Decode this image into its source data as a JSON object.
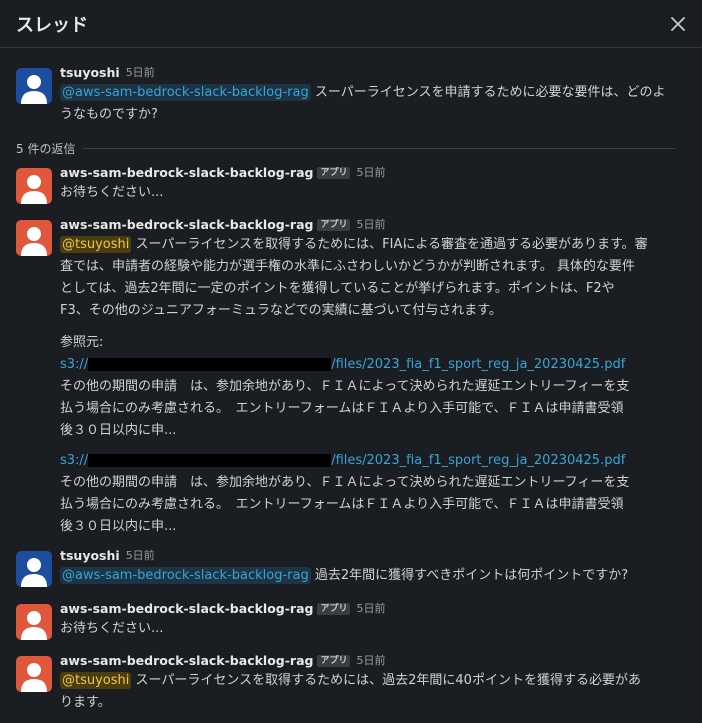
{
  "header": {
    "title": "スレッド",
    "close_label": "×"
  },
  "replies_count": "5 件の返信",
  "app_badge": "アプリ",
  "messages": [
    {
      "name": "tsuyoshi",
      "time": "5日前",
      "mention": "@aws-sam-bedrock-slack-backlog-rag",
      "text_line1": " スーパーライセンスを申請するために必要な要件は、どのよ",
      "text_line2": "うなものですか?"
    },
    {
      "name": "aws-sam-bedrock-slack-backlog-rag",
      "time": "5日前",
      "text": "お待ちください..."
    },
    {
      "name": "aws-sam-bedrock-slack-backlog-rag",
      "time": "5日前",
      "mention": "@tsuyoshi",
      "lines": [
        " スーパーライセンスを取得するためには、FIAによる審査を通過する必要があります。審",
        "査では、申請者の経験や能力が選手権の水準にふさわしいかどうかが判断されます。 具体的な要件",
        "としては、過去2年間に一定のポイントを獲得していることが挙げられます。ポイントは、F2や",
        "F3、その他のジュニアフォーミュラなどでの実績に基づいて付与されます。"
      ],
      "ref_label": "参照元:",
      "refs": [
        {
          "prefix": "s3://",
          "suffix": "/files/2023_fia_f1_sport_reg_ja_20230425.pdf",
          "lines": [
            "その他の期間の申請　は、参加余地があり、ＦＩＡによって決められた遅延エントリーフィーを支",
            "払う場合にのみ考慮される。　エントリーフォームはＦＩＡより入手可能で、ＦＩＡは申請書受領",
            "後３０日以内に申..."
          ]
        },
        {
          "prefix": "s3://",
          "suffix": "/files/2023_fia_f1_sport_reg_ja_20230425.pdf",
          "lines": [
            "その他の期間の申請　は、参加余地があり、ＦＩＡによって決められた遅延エントリーフィーを支",
            "払う場合にのみ考慮される。　エントリーフォームはＦＩＡより入手可能で、ＦＩＡは申請書受領",
            "後３０日以内に申..."
          ]
        }
      ]
    },
    {
      "name": "tsuyoshi",
      "time": "5日前",
      "mention": "@aws-sam-bedrock-slack-backlog-rag",
      "text": " 過去2年間に獲得すべきポイントは何ポイントですか?"
    },
    {
      "name": "aws-sam-bedrock-slack-backlog-rag",
      "time": "5日前",
      "text": "お待ちください..."
    },
    {
      "name": "aws-sam-bedrock-slack-backlog-rag",
      "time": "5日前",
      "mention": "@tsuyoshi",
      "text_line1": " スーパーライセンスを取得するためには、過去2年間に40ポイントを獲得する必要があ",
      "text_line2": "ります。"
    }
  ]
}
